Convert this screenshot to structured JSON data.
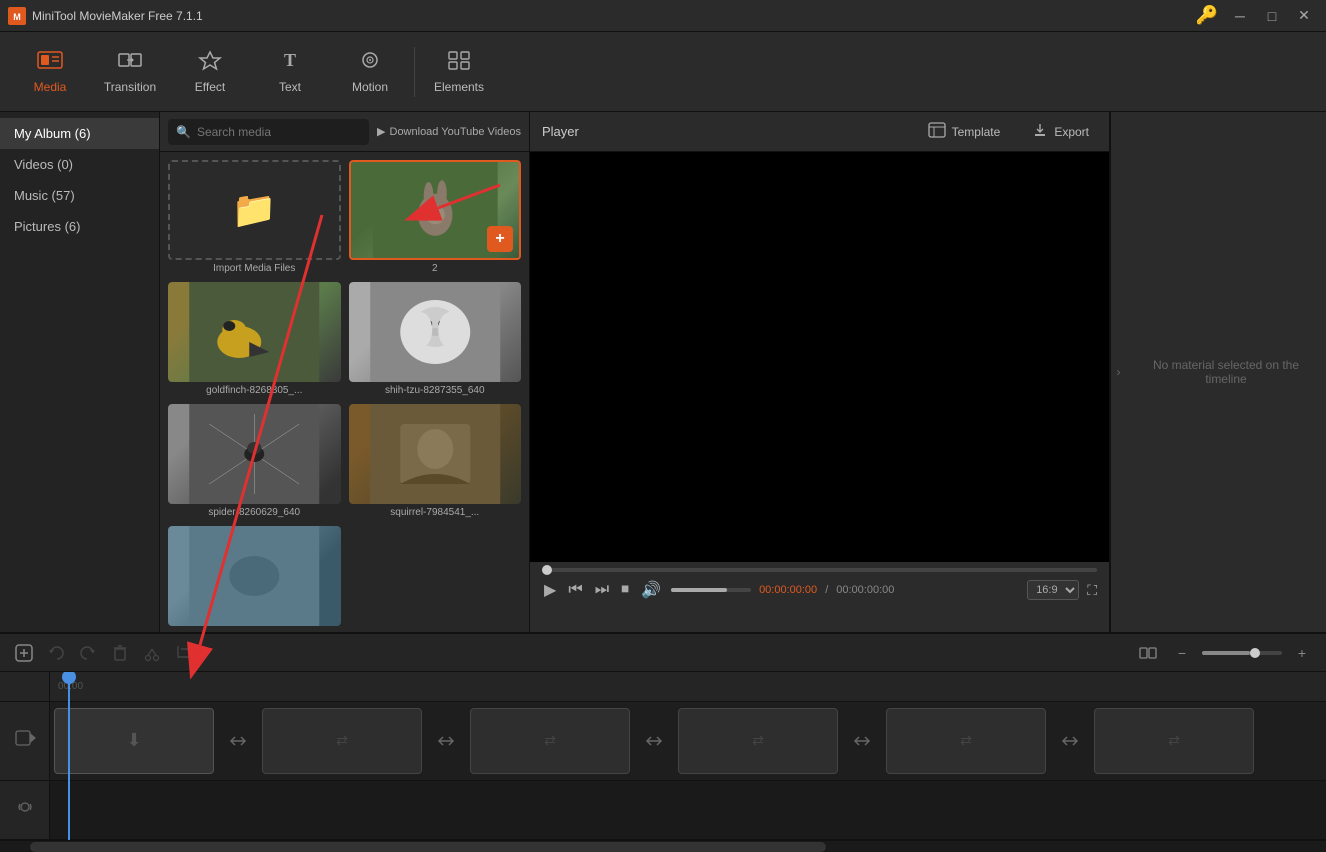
{
  "app": {
    "title": "MiniTool MovieMaker Free 7.1.1"
  },
  "titlebar": {
    "icon": "M",
    "key_icon": "🔑",
    "minimize": "─",
    "maximize": "□",
    "close": "✕"
  },
  "toolbar": {
    "items": [
      {
        "id": "media",
        "icon": "🎬",
        "label": "Media",
        "active": true
      },
      {
        "id": "transition",
        "icon": "⇄",
        "label": "Transition",
        "active": false
      },
      {
        "id": "effect",
        "icon": "✦",
        "label": "Effect",
        "active": false
      },
      {
        "id": "text",
        "icon": "T",
        "label": "Text",
        "active": false
      },
      {
        "id": "motion",
        "icon": "◎",
        "label": "Motion",
        "active": false
      },
      {
        "id": "elements",
        "icon": "⊞",
        "label": "Elements",
        "active": false
      }
    ]
  },
  "sidebar": {
    "items": [
      {
        "id": "my-album",
        "label": "My Album (6)",
        "active": true
      },
      {
        "id": "videos",
        "label": "Videos (0)",
        "active": false
      },
      {
        "id": "music",
        "label": "Music (57)",
        "active": false
      },
      {
        "id": "pictures",
        "label": "Pictures (6)",
        "active": false
      }
    ]
  },
  "media_panel": {
    "search_placeholder": "Search media",
    "download_label": "Download YouTube Videos",
    "items": [
      {
        "id": "import",
        "type": "import",
        "label": "Import Media Files"
      },
      {
        "id": "rabbit",
        "type": "image",
        "label": "2",
        "selected": true
      },
      {
        "id": "goldfinch",
        "type": "image",
        "label": "goldfinch-8268805_..."
      },
      {
        "id": "shih",
        "type": "image",
        "label": "shih-tzu-8287355_640"
      },
      {
        "id": "spider",
        "type": "image",
        "label": "spider-8260629_640"
      },
      {
        "id": "squirrel",
        "type": "image",
        "label": "squirrel-7984541_..."
      },
      {
        "id": "partial",
        "type": "image",
        "label": "..."
      }
    ]
  },
  "player": {
    "title": "Player",
    "template_label": "Template",
    "export_label": "Export",
    "time_current": "00:00:00:00",
    "time_total": "00:00:00:00",
    "time_sep": "/",
    "aspect_ratio": "16:9",
    "no_material": "No material selected on the timeline"
  },
  "timeline": {
    "tracks": [
      {
        "type": "video",
        "clips": 6
      },
      {
        "type": "audio",
        "clips": 0
      }
    ],
    "zoom_level": 60
  },
  "colors": {
    "accent": "#e05a20",
    "blue": "#4a90e2",
    "dark_bg": "#1e1e1e",
    "panel_bg": "#2b2b2b"
  }
}
